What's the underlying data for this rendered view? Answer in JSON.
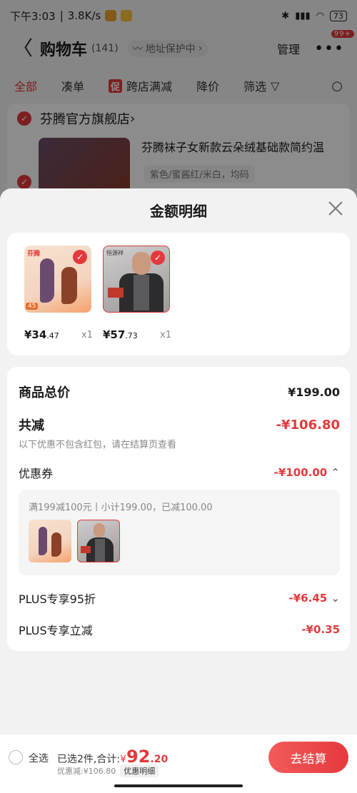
{
  "status_bar": {
    "time": "下午3:03",
    "speed": "3.8K/s",
    "battery": "73"
  },
  "header": {
    "back_glyph": "〈",
    "title": "购物车",
    "count": "(141)",
    "address": "地址保护中",
    "manage": "管理",
    "badge": "99+"
  },
  "filters": [
    {
      "label": "全部"
    },
    {
      "label": "凑单"
    },
    {
      "label": "跨店满减",
      "tag": "促"
    },
    {
      "label": "降价"
    },
    {
      "label": "筛选"
    }
  ],
  "store": {
    "name": "芬腾官方旗舰店",
    "product_name": "芬腾袜子女新款云朵绒基础款简约温",
    "spec": "紫色/蜜酱红/米白，均码"
  },
  "sheet": {
    "title": "金额明细",
    "items": [
      {
        "price_int": "¥34",
        "price_dec": ".47",
        "qty": "x1",
        "brand": "芬腾",
        "tag": "45"
      },
      {
        "price_int": "¥57",
        "price_dec": ".73",
        "qty": "x1",
        "brand": "恒源祥"
      }
    ],
    "total_label": "商品总价",
    "total_value": "¥199.00",
    "reduce_label": "共减",
    "reduce_value": "-¥106.80",
    "reduce_note": "以下优惠不包含红包，请在结算页查看",
    "coupon_label": "优惠券",
    "coupon_value": "-¥100.00",
    "coupon_desc": "满199减100元丨小计199.00，已减100.00",
    "plus95_label": "PLUS专享95折",
    "plus95_value": "-¥6.45",
    "plusoff_label": "PLUS专享立减",
    "plusoff_value": "-¥0.35"
  },
  "bottom": {
    "select_all": "全选",
    "selected_text": "已选2件,合计:",
    "yen": "¥",
    "total_int": "92",
    "total_dec": ".20",
    "discount_text": "优惠减:¥106.80",
    "detail_chip": "优惠明细",
    "checkout": "去结算"
  },
  "colors": {
    "accent": "#e4393c"
  }
}
